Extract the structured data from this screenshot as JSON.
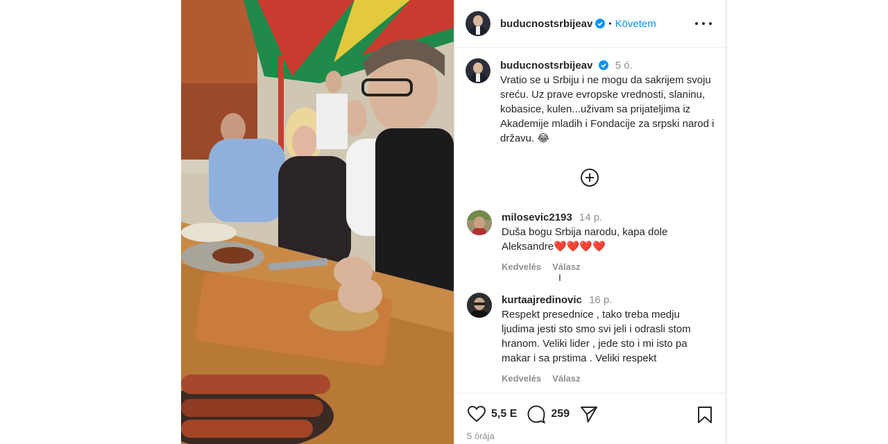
{
  "post": {
    "username": "buducnostsrbijeav",
    "follow_label": "Követem",
    "caption_time": "5 ó.",
    "caption_text": "Vratio se u Srbiju i ne mogu da sakrijem svoju sreću. Uz prave evropske vrednosti, slaninu, kobasice, kulen...uživam sa prijateljima iz Akademije mladih i Fondacije za srpski narod i državu. 😂"
  },
  "comments": [
    {
      "username": "milosevic2193",
      "time": "14 p.",
      "text": "Duša bogu Srbija narodu, kapa dole Aleksandre❤️❤️❤️❤️",
      "like_label": "Kedvelés",
      "reply_label": "Válasz"
    },
    {
      "username": "kurtaajredinovic",
      "time": "16 p.",
      "text": "Respekt presednice , tako treba medju ljudima jesti sto smo svi jeli i odrasli stom hranom. Veliki lider , jede sto i mi isto pa makar i sa prstima . Veliki respekt",
      "like_label": "Kedvelés",
      "reply_label": "Válasz"
    }
  ],
  "stats": {
    "likes": "5,5 E",
    "comments": "259",
    "posted_ago": "5 órája"
  },
  "icons": {
    "like": "heart-icon",
    "comment": "comment-icon",
    "share": "share-icon",
    "save": "bookmark-icon",
    "more": "more-icon",
    "verified": "verified-icon",
    "load_more": "plus-circle-icon"
  },
  "colors": {
    "link": "#0095f6",
    "verified": "#0095f6",
    "muted": "#8e8e8e"
  }
}
